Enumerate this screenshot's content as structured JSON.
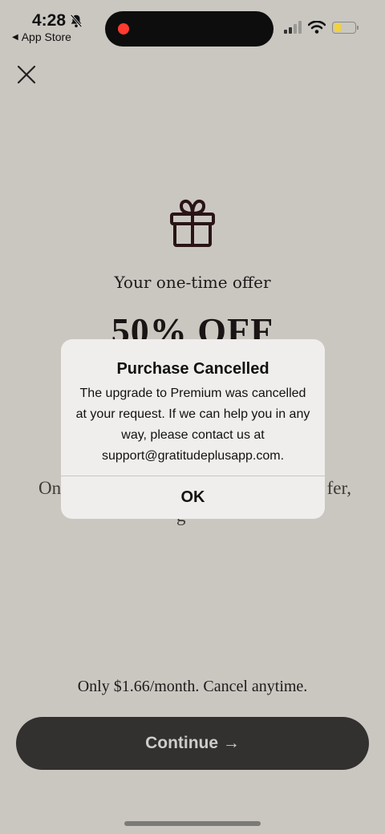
{
  "status_bar": {
    "time": "4:28",
    "back_label": "App Store"
  },
  "offer": {
    "subtitle": "Your one-time offer",
    "headline": "50% OFF",
    "obscured_left": "On",
    "obscured_right": "fer,",
    "obscured_line2": "g"
  },
  "price_text": "Only $1.66/month. Cancel anytime.",
  "continue_label": "Continue →",
  "alert": {
    "title": "Purchase Cancelled",
    "message": "The upgrade to Premium was cancelled at your request. If we can help you in any way, please contact us at support@gratitudeplusapp.com.",
    "ok_label": "OK"
  },
  "colors": {
    "background": "#cac7c1",
    "button": "#323130",
    "alert_bg": "#efeeec",
    "record_dot": "#ff3b30",
    "battery": "#f2d23c"
  }
}
